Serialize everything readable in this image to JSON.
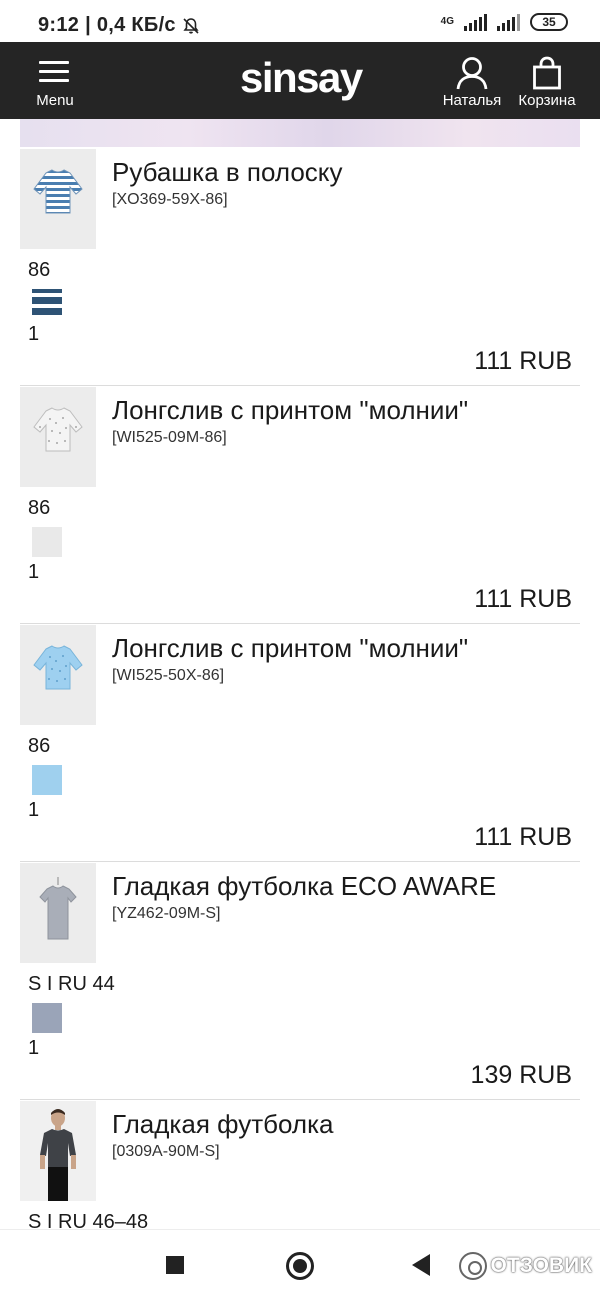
{
  "status_bar": {
    "time_speed": "9:12 | 0,4 КБ/с",
    "network": "4G",
    "battery": "35"
  },
  "header": {
    "menu_label": "Menu",
    "logo": "sinsay",
    "account_label": "Наталья",
    "cart_label": "Корзина"
  },
  "cart_items": [
    {
      "title": "Рубашка в полоску",
      "sku": "[XO369-59X-86]",
      "size": "86",
      "quantity": "1",
      "price": "111 RUB",
      "swatch": "navy-white stripes"
    },
    {
      "title": "Лонгслив с принтом \"молнии\"",
      "sku": "[WI525-09M-86]",
      "size": "86",
      "quantity": "1",
      "price": "111 RUB",
      "swatch": "light grey print"
    },
    {
      "title": "Лонгслив с принтом \"молнии\"",
      "sku": "[WI525-50X-86]",
      "size": "86",
      "quantity": "1",
      "price": "111 RUB",
      "swatch": "light blue print"
    },
    {
      "title": "Гладкая футболка ECO AWARE",
      "sku": "[YZ462-09M-S]",
      "size": "S I RU 44",
      "quantity": "1",
      "price": "139 RUB",
      "swatch": "grey melange"
    },
    {
      "title": "Гладкая футболка",
      "sku": "[0309A-90M-S]",
      "size": "S I RU 46–48",
      "quantity": "",
      "price": "",
      "swatch": "dark grey"
    }
  ],
  "watermark": "ОТЗОВИК",
  "colors": {
    "header_bg": "#252525",
    "text": "#1a1a1a"
  }
}
